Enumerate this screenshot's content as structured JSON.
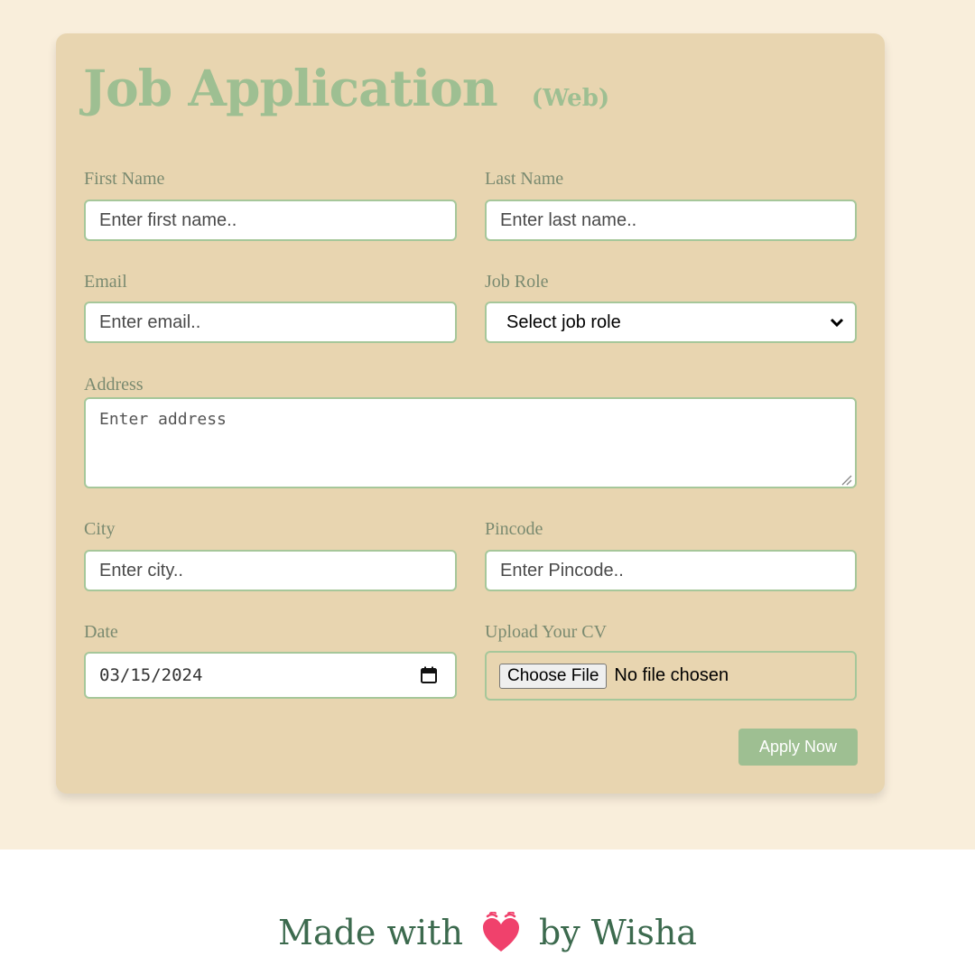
{
  "form": {
    "title": "Job Application",
    "subtitle": "(Web)",
    "first_name": {
      "label": "First Name",
      "placeholder": "Enter first name.."
    },
    "last_name": {
      "label": "Last Name",
      "placeholder": "Enter last name.."
    },
    "email": {
      "label": "Email",
      "placeholder": "Enter email.."
    },
    "job_role": {
      "label": "Job Role",
      "selected": "Select job role"
    },
    "address": {
      "label": "Address",
      "placeholder": "Enter address"
    },
    "city": {
      "label": "City",
      "placeholder": "Enter city.."
    },
    "pincode": {
      "label": "Pincode",
      "placeholder": "Enter Pincode.."
    },
    "date": {
      "label": "Date",
      "value": "03/15/2024"
    },
    "cv": {
      "label": "Upload Your CV",
      "button": "Choose File",
      "status": "No file chosen"
    },
    "apply_label": "Apply Now"
  },
  "footer": {
    "prefix": "Made with",
    "suffix": "by Wisha",
    "icon": "heart-icon"
  },
  "colors": {
    "page_bg": "#f9eedb",
    "card_bg": "#e8d5b0",
    "accent": "#9ebf92",
    "footer_text": "#3c6a4e",
    "heart": "#f0416c"
  }
}
